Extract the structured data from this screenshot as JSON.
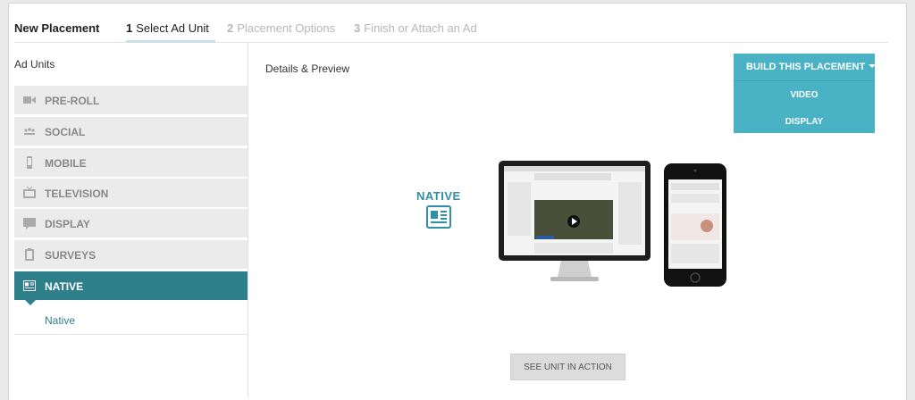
{
  "header": {
    "title": "New Placement",
    "steps": [
      {
        "num": "1",
        "label": "Select Ad Unit"
      },
      {
        "num": "2",
        "label": "Placement Options"
      },
      {
        "num": "3",
        "label": "Finish or Attach an Ad"
      }
    ]
  },
  "sidebar": {
    "title": "Ad Units",
    "items": [
      {
        "label": "PRE-ROLL",
        "icon": "video-camera-icon"
      },
      {
        "label": "SOCIAL",
        "icon": "social-icon"
      },
      {
        "label": "MOBILE",
        "icon": "mobile-phone-icon"
      },
      {
        "label": "TELEVISION",
        "icon": "television-icon"
      },
      {
        "label": "DISPLAY",
        "icon": "display-icon"
      },
      {
        "label": "SURVEYS",
        "icon": "clipboard-icon"
      },
      {
        "label": "NATIVE",
        "icon": "native-icon"
      }
    ],
    "selected_index": 6,
    "subitem": "Native"
  },
  "main": {
    "title": "Details & Preview",
    "build_button": "BUILD THIS PLACEMENT",
    "dropdown": [
      "VIDEO",
      "DISPLAY"
    ],
    "native_logo_text": "NATIVE",
    "see_button": "SEE UNIT IN ACTION"
  },
  "colors": {
    "accent_teal": "#2e7f8c",
    "button_blue": "#4ab2c5",
    "native_blue": "#2e8fa5"
  }
}
